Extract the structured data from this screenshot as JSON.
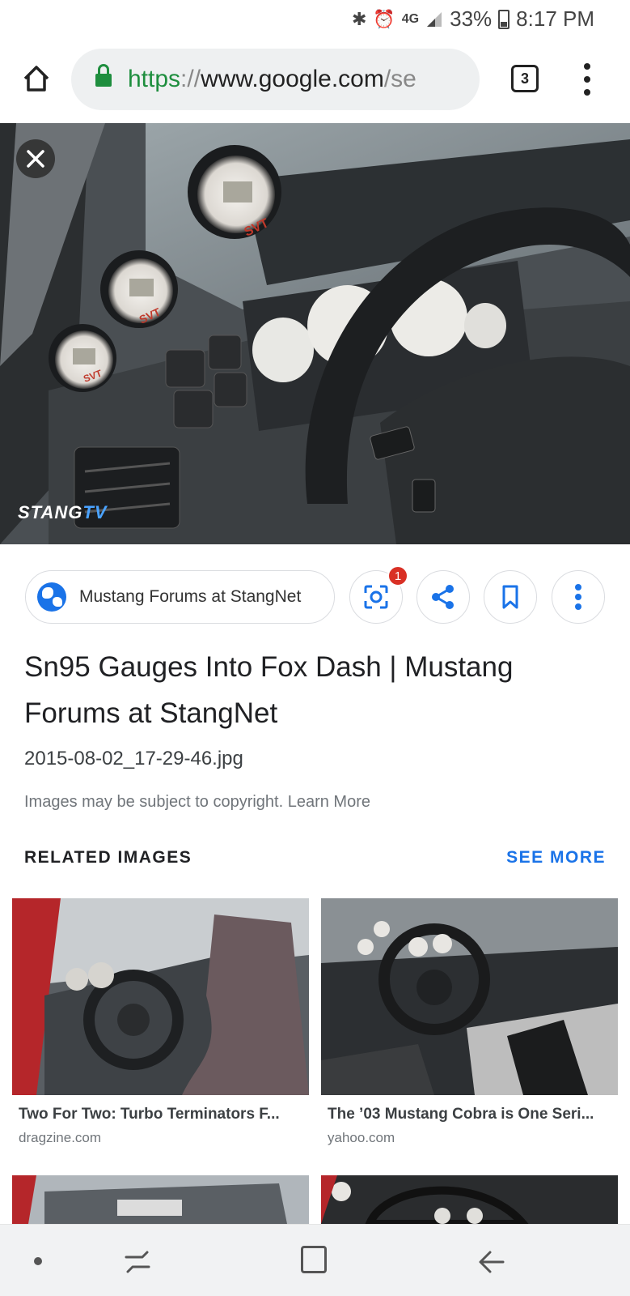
{
  "status_bar": {
    "network": "4G",
    "battery": "33%",
    "time": "8:17 PM",
    "icons": [
      "bluetooth-icon",
      "alarm-icon",
      "signal-icon",
      "battery-icon"
    ]
  },
  "browser": {
    "url_scheme": "https",
    "url_sep": "://",
    "url_host": "www.google.com",
    "url_path": "/se",
    "tab_count": "3"
  },
  "hero": {
    "watermark_a": "STANG",
    "watermark_b": "TV"
  },
  "source": {
    "label": "Mustang Forums at StangNet",
    "lens_badge": "1"
  },
  "result": {
    "title": "Sn95 Gauges Into Fox Dash | Mustang Forums at StangNet",
    "filename": "2015-08-02_17-29-46.jpg",
    "copyright": "Images may be subject to copyright. Learn More"
  },
  "related": {
    "header": "RELATED IMAGES",
    "see_more": "SEE MORE",
    "items": [
      {
        "title": "Two For Two: Turbo Terminators F...",
        "domain": "dragzine.com"
      },
      {
        "title": "The ’03 Mustang Cobra is One Seri...",
        "domain": "yahoo.com"
      }
    ]
  },
  "colors": {
    "accent": "#1a73e8",
    "secure": "#1e8e3e",
    "badge": "#d93025"
  }
}
